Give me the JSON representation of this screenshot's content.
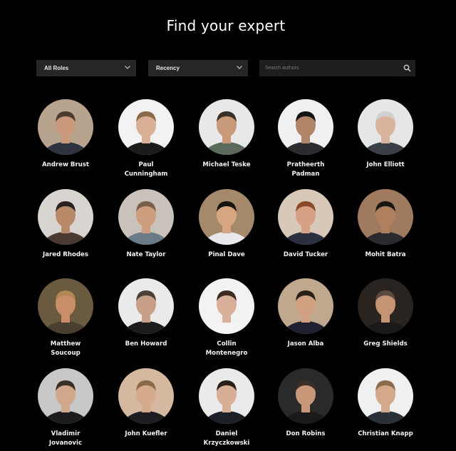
{
  "page": {
    "title": "Find your expert"
  },
  "filters": {
    "roles_label": "All Roles",
    "recency_label": "Recency",
    "search_placeholder": "Search authors",
    "search_value": ""
  },
  "icons": {
    "dropdown": "chevron-down-icon",
    "search": "search-icon"
  },
  "colors": {
    "background": "#000000",
    "control_bg": "#262626",
    "text": "#ffffff"
  },
  "authors": [
    {
      "name": "Andrew Brust",
      "bg": "#b8a48e",
      "skin": "#c99a7b",
      "shirt": "#2e3340",
      "hair": "#4a3a30"
    },
    {
      "name": "Paul\nCunningham",
      "bg": "#f2f2f2",
      "skin": "#d9b094",
      "shirt": "#1b1b1b",
      "hair": "#8a6a4a"
    },
    {
      "name": "Michael Teske",
      "bg": "#e8e8e8",
      "skin": "#c89a7a",
      "shirt": "#5b6a5a",
      "hair": "#3a3028"
    },
    {
      "name": "Pratheerth\nPadman",
      "bg": "#f0f0f0",
      "skin": "#b08466",
      "shirt": "#2b2b30",
      "hair": "#141414"
    },
    {
      "name": "John Elliott",
      "bg": "#e6e6e6",
      "skin": "#d8b49c",
      "shirt": "#3a3f48",
      "hair": "#d0d0d0"
    },
    {
      "name": "Jared Rhodes",
      "bg": "#d8d4d0",
      "skin": "#b88a6a",
      "shirt": "#4a3a34",
      "hair": "#2a2220"
    },
    {
      "name": "Nate Taylor",
      "bg": "#c8c2ba",
      "skin": "#cc9e7e",
      "shirt": "#6a7a86",
      "hair": "#7a6048"
    },
    {
      "name": "Pinal Dave",
      "bg": "#a48a6a",
      "skin": "#d6a682",
      "shirt": "#e8e8ec",
      "hair": "#1a1410"
    },
    {
      "name": "David Tucker",
      "bg": "#d8c8b8",
      "skin": "#d6a084",
      "shirt": "#2a3040",
      "hair": "#8a4a28"
    },
    {
      "name": "Mohit Batra",
      "bg": "#a07a5e",
      "skin": "#b0805e",
      "shirt": "#2a2a30",
      "hair": "#1a1614"
    },
    {
      "name": "Matthew\nSoucoup",
      "bg": "#6a5a40",
      "skin": "#c88e68",
      "shirt": "#4a4030",
      "hair": "#b08850"
    },
    {
      "name": "Ben Howard",
      "bg": "#eaeaea",
      "skin": "#c8a088",
      "shirt": "#1c1c1c",
      "hair": "#4a4038"
    },
    {
      "name": "Collin\nMontenegro",
      "bg": "#f2f2f2",
      "skin": "#d8b09a",
      "shirt": "#f4f4f4",
      "hair": "#3a2a22"
    },
    {
      "name": "Jason Alba",
      "bg": "#bfa88e",
      "skin": "#d0a080",
      "shirt": "#1e2230",
      "hair": "#2a2018"
    },
    {
      "name": "Greg Shields",
      "bg": "#2a2420",
      "skin": "#c49474",
      "shirt": "#1a1a1a",
      "hair": "#5a4a40"
    },
    {
      "name": "Vladimir\nJovanovic",
      "bg": "#c8c8c8",
      "skin": "#d2a88c",
      "shirt": "#1c1c1c",
      "hair": "#3a3028"
    },
    {
      "name": "John Kuefler",
      "bg": "#d4b8a0",
      "skin": "#d6aa8c",
      "shirt": "#1e1e22",
      "hair": "#8a6a48"
    },
    {
      "name": "Daniel\nKrzyczkowski",
      "bg": "#eaeaea",
      "skin": "#d8ae94",
      "shirt": "#1c2028",
      "hair": "#2a2018"
    },
    {
      "name": "Don Robins",
      "bg": "#2a2a2a",
      "skin": "#c89878",
      "shirt": "#1a1a1a",
      "hair": "#3a3028"
    },
    {
      "name": "Christian Knapp",
      "bg": "#f0f0f0",
      "skin": "#d4a88a",
      "shirt": "#2a3038",
      "hair": "#8a6a4a"
    }
  ]
}
